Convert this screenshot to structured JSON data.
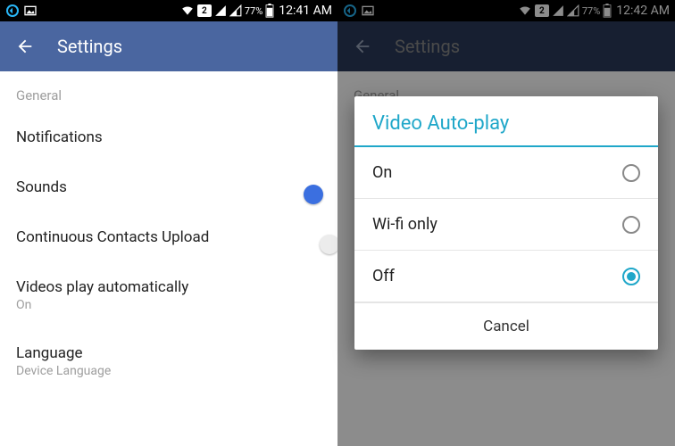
{
  "left": {
    "status": {
      "sim": "2",
      "battery": "77%",
      "time": "12:41 AM"
    },
    "appbar": {
      "title": "Settings"
    },
    "section": "General",
    "rows": {
      "notifications": "Notifications",
      "sounds": "Sounds",
      "contacts": "Continuous Contacts Upload",
      "videos_label": "Videos play automatically",
      "videos_value": "On",
      "language_label": "Language",
      "language_value": "Device Language"
    }
  },
  "right": {
    "status": {
      "sim": "2",
      "battery": "77%",
      "time": "12:42 AM"
    },
    "appbar": {
      "title": "Settings"
    },
    "section": "General",
    "dialog": {
      "title": "Video Auto-play",
      "options": {
        "on": "On",
        "wifi": "Wi-fi only",
        "off": "Off"
      },
      "selected": "off",
      "cancel": "Cancel"
    }
  }
}
